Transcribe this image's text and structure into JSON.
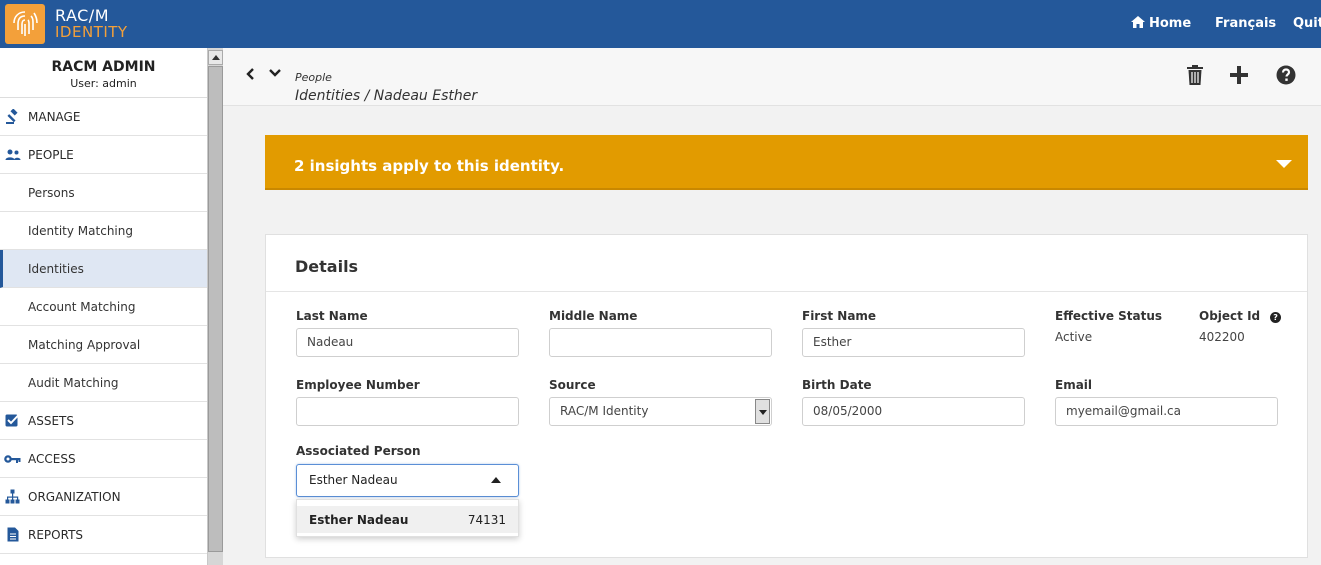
{
  "brand": {
    "line1": "RAC/M",
    "line2": "IDENTITY",
    "accent": "#f3a03a",
    "bar_color": "#24589a"
  },
  "topnav": {
    "home": "Home",
    "language": "Français",
    "quit": "Quit"
  },
  "user": {
    "name": "RACM ADMIN",
    "role": "User: admin"
  },
  "sidebar": {
    "items": [
      {
        "label": "MANAGE",
        "icon": "gavel-icon",
        "kind": "top"
      },
      {
        "label": "PEOPLE",
        "icon": "people-icon",
        "kind": "top"
      },
      {
        "label": "Persons",
        "kind": "sub"
      },
      {
        "label": "Identity Matching",
        "kind": "sub"
      },
      {
        "label": "Identities",
        "kind": "sub",
        "active": true
      },
      {
        "label": "Account Matching",
        "kind": "sub"
      },
      {
        "label": "Matching Approval",
        "kind": "sub"
      },
      {
        "label": "Audit Matching",
        "kind": "sub"
      },
      {
        "label": "ASSETS",
        "icon": "checkbox-icon",
        "kind": "top"
      },
      {
        "label": "ACCESS",
        "icon": "key-icon",
        "kind": "top"
      },
      {
        "label": "ORGANIZATION",
        "icon": "org-chart-icon",
        "kind": "top"
      },
      {
        "label": "REPORTS",
        "icon": "document-icon",
        "kind": "top"
      }
    ]
  },
  "breadcrumb": {
    "section": "People",
    "path": "Identities / Nadeau Esther"
  },
  "insights": {
    "text": "2 insights apply to this identity.",
    "color": "#e29b00"
  },
  "details": {
    "title": "Details",
    "last_name": {
      "label": "Last Name",
      "value": "Nadeau"
    },
    "middle_name": {
      "label": "Middle Name",
      "value": ""
    },
    "first_name": {
      "label": "First Name",
      "value": "Esther"
    },
    "effective_status": {
      "label": "Effective Status",
      "value": "Active"
    },
    "object_id": {
      "label": "Object Id",
      "value": "402200"
    },
    "employee_number": {
      "label": "Employee Number",
      "value": ""
    },
    "source": {
      "label": "Source",
      "value": "RAC/M Identity"
    },
    "birth_date": {
      "label": "Birth Date",
      "value": "08/05/2000"
    },
    "email": {
      "label": "Email",
      "value": "myemail@gmail.ca"
    },
    "associated_person": {
      "label": "Associated Person",
      "value": "Esther Nadeau",
      "options": [
        {
          "name": "Esther Nadeau",
          "id": "74131"
        }
      ]
    }
  }
}
